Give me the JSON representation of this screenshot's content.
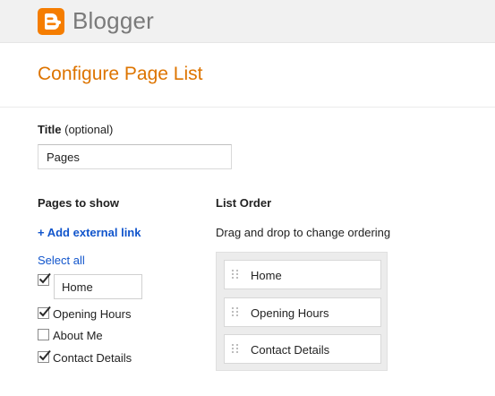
{
  "app": {
    "brand_name": "Blogger",
    "logo_icon": "blogger-logo-icon",
    "brand_color": "#f57d00"
  },
  "page": {
    "title": "Configure Page List",
    "title_color": "#dd7400"
  },
  "title_field": {
    "label": "Title",
    "hint": " (optional)",
    "value": "Pages"
  },
  "pages_to_show": {
    "heading": "Pages to show",
    "add_link": "+ Add external link",
    "select_all": "Select all",
    "items": [
      {
        "label": "Home",
        "checked": true,
        "editing": true
      },
      {
        "label": "Opening Hours",
        "checked": true
      },
      {
        "label": "About Me",
        "checked": false
      },
      {
        "label": "Contact Details",
        "checked": true
      }
    ]
  },
  "list_order": {
    "heading": "List Order",
    "description": "Drag and drop to change ordering",
    "items": [
      {
        "label": "Home",
        "icon": "drag-handle-icon"
      },
      {
        "label": "Opening Hours",
        "icon": "drag-handle-icon"
      },
      {
        "label": "Contact Details",
        "icon": "drag-handle-icon"
      }
    ]
  },
  "colors": {
    "link": "#1155cc",
    "topbar": "#f1f1f1",
    "list_bg": "#ececec"
  }
}
